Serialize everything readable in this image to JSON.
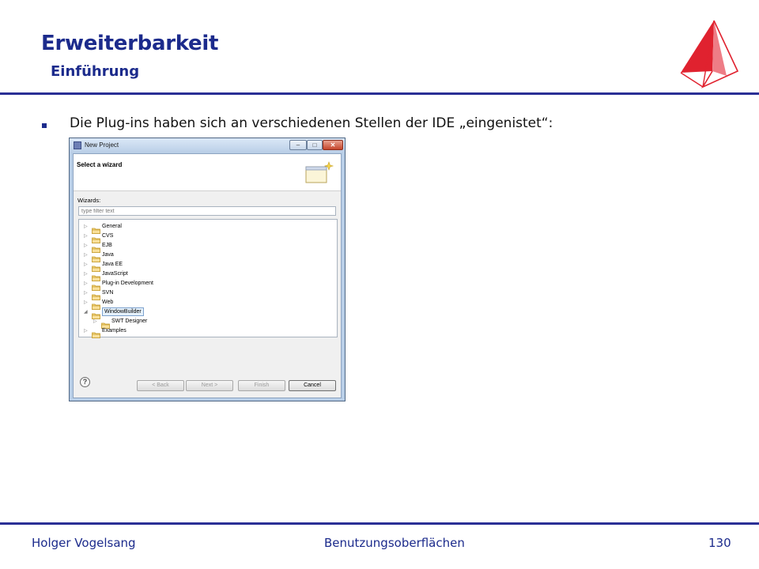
{
  "slide": {
    "title": "Erweiterbarkeit",
    "subtitle": "Einführung",
    "bullet": "Die Plug-ins haben sich an verschiedenen Stellen der IDE „eingenistet“:"
  },
  "dialog": {
    "window_title": "New Project",
    "banner_title": "Select a wizard",
    "wizards_label": "Wizards:",
    "filter_placeholder": "type filter text",
    "tree_items": [
      {
        "label": "General",
        "expanded": false,
        "level": 0
      },
      {
        "label": "CVS",
        "expanded": false,
        "level": 0
      },
      {
        "label": "EJB",
        "expanded": false,
        "level": 0
      },
      {
        "label": "Java",
        "expanded": false,
        "level": 0
      },
      {
        "label": "Java EE",
        "expanded": false,
        "level": 0
      },
      {
        "label": "JavaScript",
        "expanded": false,
        "level": 0
      },
      {
        "label": "Plug-in Development",
        "expanded": false,
        "level": 0
      },
      {
        "label": "SVN",
        "expanded": false,
        "level": 0
      },
      {
        "label": "Web",
        "expanded": false,
        "level": 0
      },
      {
        "label": "WindowBuilder",
        "expanded": true,
        "level": 0,
        "selected": true
      },
      {
        "label": "SWT Designer",
        "expanded": false,
        "level": 1
      },
      {
        "label": "Examples",
        "expanded": false,
        "level": 0
      }
    ],
    "buttons": {
      "back": "< Back",
      "next": "Next >",
      "finish": "Finish",
      "cancel": "Cancel"
    },
    "help_icon": "?"
  },
  "footer": {
    "author": "Holger Vogelsang",
    "course": "Benutzungsoberflächen",
    "page": "130"
  },
  "colors": {
    "accent": "#1c2b8c",
    "rule": "#2a2f95",
    "logo_red": "#e0222f"
  },
  "icons": {
    "logo": "sail-logo-icon",
    "folder": "folder-icon",
    "help": "help-icon",
    "wizard_banner": "wizard-banner-icon"
  }
}
